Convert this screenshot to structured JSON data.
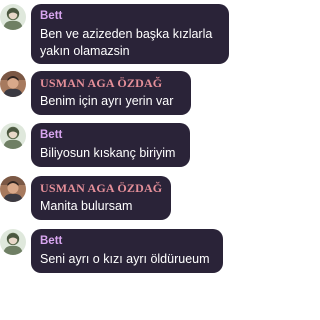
{
  "colors": {
    "bubble_bg": "#2a2338",
    "bett_name": "#d9a6f0",
    "usman_name": "#e58f99",
    "message_text": "#ffffff",
    "page_bg": "#ffffff"
  },
  "messages": [
    {
      "author": "Bett",
      "avatar": "bett-avatar",
      "text": "Ben ve azizeden başka kızlarla yakın olamazsin"
    },
    {
      "author": "USMAN AGA ÖZDAĞ",
      "avatar": "usman-avatar",
      "text": "Benim için ayrı yerin var"
    },
    {
      "author": "Bett",
      "avatar": "bett-avatar",
      "text": "Biliyosun kıskanç biriyim"
    },
    {
      "author": "USMAN AGA ÖZDAĞ",
      "avatar": "usman-avatar",
      "text": "Manita bulursam"
    },
    {
      "author": "Bett",
      "avatar": "bett-avatar",
      "text": "Seni ayrı o kızı ayrı öldürueum"
    }
  ]
}
